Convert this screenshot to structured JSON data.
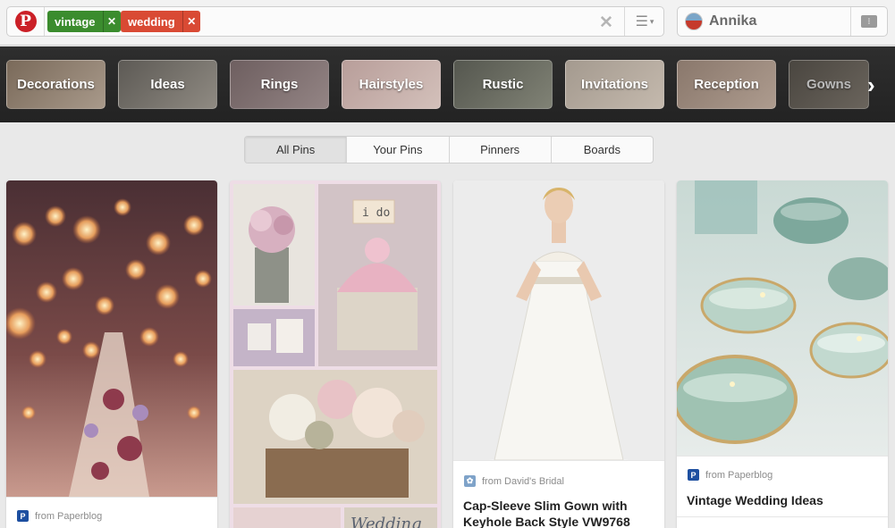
{
  "search": {
    "tags": [
      {
        "label": "vintage",
        "color": "#3b8c2e"
      },
      {
        "label": "wedding",
        "color": "#d94a34"
      }
    ],
    "clear_icon": "close-icon",
    "menu_icon": "list-menu-icon"
  },
  "user": {
    "name": "Annika",
    "notification_icon": "notification-bubble-icon"
  },
  "categories": [
    "Decorations",
    "Ideas",
    "Rings",
    "Hairstyles",
    "Rustic",
    "Invitations",
    "Reception",
    "Gowns"
  ],
  "filters": {
    "items": [
      "All Pins",
      "Your Pins",
      "Pinners",
      "Boards"
    ],
    "selected": "All Pins"
  },
  "pins": [
    {
      "source": "from Paperblog",
      "source_icon": "P"
    },
    {
      "source": "",
      "title": ""
    },
    {
      "source": "from David's Bridal",
      "title_line1": "Cap-Sleeve Slim Gown with",
      "title_line2": "Keyhole Back Style VW9768"
    },
    {
      "source": "from Paperblog",
      "source_icon": "P",
      "title": "Vintage Wedding Ideas"
    }
  ],
  "collage_text": {
    "cupcake_flag": "i do",
    "sign": "Wedding"
  }
}
